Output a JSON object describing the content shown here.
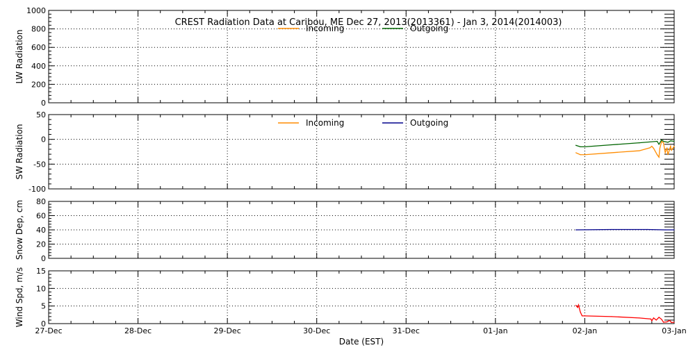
{
  "title": "CREST Radiation Data at Caribou, ME   Dec 27, 2013(2013361) - Jan  3, 2014(2014003)",
  "xlabel": "Date (EST)",
  "x_tick_labels": [
    "27-Dec",
    "28-Dec",
    "29-Dec",
    "30-Dec",
    "31-Dec",
    "01-Jan",
    "02-Jan",
    "03-Jan"
  ],
  "chart_data": [
    {
      "type": "line",
      "name": "lw",
      "ylabel": "LW Radiation",
      "ylim": [
        0,
        1000
      ],
      "yticks": [
        0,
        200,
        400,
        600,
        800,
        1000
      ],
      "xlim": [
        0,
        7
      ],
      "legend": [
        {
          "name": "Incoming",
          "color": "#ff8c00"
        },
        {
          "name": "Outgoing",
          "color": "#006400"
        }
      ],
      "series": [
        {
          "name": "Incoming",
          "color": "#ff8c00",
          "points": []
        },
        {
          "name": "Outgoing",
          "color": "#006400",
          "points": []
        }
      ]
    },
    {
      "type": "line",
      "name": "sw",
      "ylabel": "SW Radiation",
      "ylim": [
        -100,
        50
      ],
      "yticks": [
        -100,
        -50,
        0,
        50
      ],
      "xlim": [
        0,
        7
      ],
      "legend": [
        {
          "name": "Incoming",
          "color": "#ff8c00"
        },
        {
          "name": "Outgoing",
          "color": "#00008b"
        }
      ],
      "series": [
        {
          "name": "Incoming",
          "color": "#ff8c00",
          "points": [
            [
              5.9,
              -27
            ],
            [
              5.95,
              -31
            ],
            [
              6.0,
              -31
            ],
            [
              6.3,
              -27
            ],
            [
              6.61,
              -23
            ],
            [
              6.73,
              -17
            ],
            [
              6.75,
              -14
            ],
            [
              6.77,
              -18
            ],
            [
              6.81,
              -31
            ],
            [
              6.83,
              -36
            ],
            [
              6.84,
              -18
            ],
            [
              6.86,
              -4
            ],
            [
              6.88,
              -7
            ],
            [
              6.9,
              -27
            ],
            [
              6.92,
              -17
            ],
            [
              6.93,
              -31
            ],
            [
              6.96,
              -14
            ],
            [
              6.97,
              -22
            ],
            [
              7.0,
              -14
            ]
          ]
        },
        {
          "name": "Outgoing",
          "color": "#006400",
          "points": [
            [
              5.9,
              -12
            ],
            [
              5.95,
              -15
            ],
            [
              6.0,
              -15
            ],
            [
              6.3,
              -11
            ],
            [
              6.61,
              -7
            ],
            [
              6.81,
              -4
            ],
            [
              6.83,
              -10
            ],
            [
              6.86,
              -1
            ],
            [
              6.88,
              -4
            ],
            [
              6.93,
              -6
            ],
            [
              6.96,
              -3
            ],
            [
              7.0,
              -4
            ]
          ]
        }
      ]
    },
    {
      "type": "line",
      "name": "snow",
      "ylabel": "Snow Dep, cm",
      "ylim": [
        0,
        80
      ],
      "yticks": [
        0,
        20,
        40,
        60,
        80
      ],
      "xlim": [
        0,
        7
      ],
      "series": [
        {
          "name": "Snow depth",
          "color": "#00008b",
          "points": [
            [
              5.9,
              40
            ],
            [
              6.3,
              40.5
            ],
            [
              6.7,
              40.5
            ],
            [
              6.9,
              40
            ],
            [
              7.0,
              40
            ]
          ]
        }
      ]
    },
    {
      "type": "line",
      "name": "wind",
      "ylabel": "Wind Spd, m/s",
      "ylim": [
        0,
        15
      ],
      "yticks": [
        0,
        5,
        10,
        15
      ],
      "xlim": [
        0,
        7
      ],
      "series": [
        {
          "name": "Wind speed",
          "color": "#ff0000",
          "points": [
            [
              5.9,
              5.2
            ],
            [
              5.92,
              4.6
            ],
            [
              5.93,
              5.3
            ],
            [
              5.95,
              3.3
            ],
            [
              5.97,
              2.2
            ],
            [
              6.0,
              2.2
            ],
            [
              6.3,
              2.0
            ],
            [
              6.61,
              1.6
            ],
            [
              6.74,
              1.3
            ],
            [
              6.75,
              0.8
            ],
            [
              6.77,
              1.6
            ],
            [
              6.8,
              1.0
            ],
            [
              6.83,
              1.8
            ],
            [
              6.86,
              1.2
            ],
            [
              6.88,
              0.4
            ],
            [
              6.92,
              0.5
            ],
            [
              6.95,
              0.9
            ],
            [
              6.97,
              0.3
            ],
            [
              7.0,
              0.4
            ]
          ]
        }
      ]
    }
  ]
}
